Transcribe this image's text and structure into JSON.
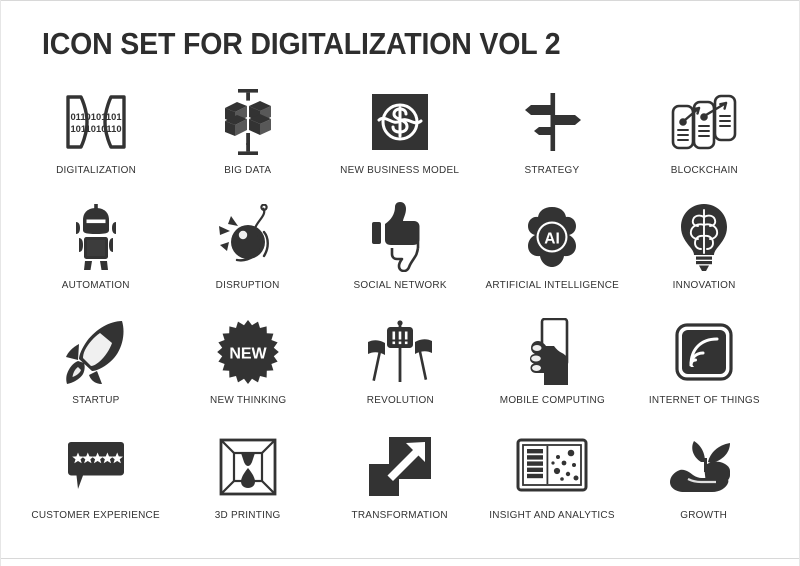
{
  "page": {
    "title": "ICON SET FOR DIGITALIZATION VOL 2",
    "background_color": "#ffffff",
    "icon_color": "#333333",
    "title_color": "#2e2e2e",
    "columns": 5,
    "rows": 4
  },
  "icons": [
    {
      "label": "DIGITALIZATION",
      "name": "digitalization-icon",
      "glyph": "brackets-binary",
      "binary_top": "0110101101",
      "binary_bottom": "1011010110"
    },
    {
      "label": "BIG DATA",
      "name": "big-data-icon",
      "glyph": "cube-cluster"
    },
    {
      "label": "NEW BUSINESS MODEL",
      "name": "new-business-model-icon",
      "glyph": "dollar-cycle-square"
    },
    {
      "label": "STRATEGY",
      "name": "strategy-icon",
      "glyph": "signpost"
    },
    {
      "label": "BLOCKCHAIN",
      "name": "blockchain-icon",
      "glyph": "linked-blocks"
    },
    {
      "label": "AUTOMATION",
      "name": "automation-icon",
      "glyph": "robot"
    },
    {
      "label": "DISRUPTION",
      "name": "disruption-icon",
      "glyph": "wrecking-ball"
    },
    {
      "label": "SOCIAL NETWORK",
      "name": "social-network-icon",
      "glyph": "thumbs-up-down"
    },
    {
      "label": "ARTIFICIAL INTELLIGENCE",
      "name": "artificial-intelligence-icon",
      "glyph": "ai-brain-badge",
      "badge_text": "AI"
    },
    {
      "label": "INNOVATION",
      "name": "innovation-icon",
      "glyph": "brain-bulb"
    },
    {
      "label": "STARTUP",
      "name": "startup-icon",
      "glyph": "rocket"
    },
    {
      "label": "NEW THINKING",
      "name": "new-thinking-icon",
      "glyph": "starburst-badge",
      "badge_text": "NEW"
    },
    {
      "label": "REVOLUTION",
      "name": "revolution-icon",
      "glyph": "protest-sign",
      "sign_text": "!!!"
    },
    {
      "label": "MOBILE COMPUTING",
      "name": "mobile-computing-icon",
      "glyph": "hand-smartphone"
    },
    {
      "label": "INTERNET OF THINGS",
      "name": "internet-of-things-icon",
      "glyph": "signal-square"
    },
    {
      "label": "CUSTOMER EXPERIENCE",
      "name": "customer-experience-icon",
      "glyph": "speech-stars",
      "stars": 5
    },
    {
      "label": "3D PRINTING",
      "name": "3d-printing-icon",
      "glyph": "printer-box-drop"
    },
    {
      "label": "TRANSFORMATION",
      "name": "transformation-icon",
      "glyph": "squares-arrow"
    },
    {
      "label": "INSIGHT AND ANALYTICS",
      "name": "insight-and-analytics-icon",
      "glyph": "chart-scatter-panel"
    },
    {
      "label": "GROWTH",
      "name": "growth-icon",
      "glyph": "hand-sprout"
    }
  ]
}
